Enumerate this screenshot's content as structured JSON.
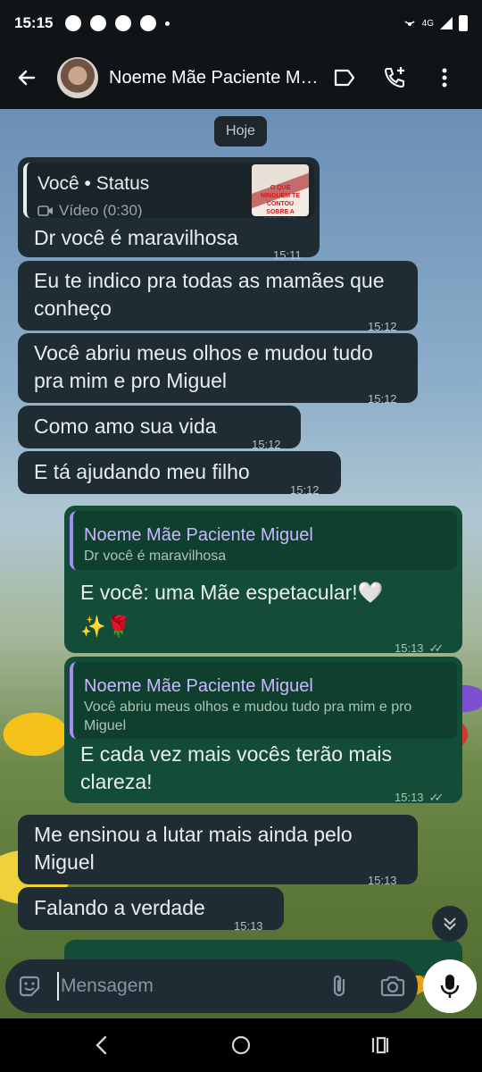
{
  "status_bar": {
    "time": "15:15",
    "network": "4G"
  },
  "header": {
    "contact_name": "Noeme Mãe Paciente Miguel",
    "icons": [
      "back-arrow-icon",
      "label-icon",
      "add-call-icon",
      "more-vert-icon"
    ]
  },
  "chat": {
    "date_label": "Hoje",
    "status_reply": {
      "title": "Você • Status",
      "subtitle": "Vídeo (0:30)",
      "thumb_text": "O QUE NINGUÉM TE CONTOU SOBRE A PREGUIÇA"
    },
    "messages": [
      {
        "dir": "in",
        "text": "Dr você é maravilhosa",
        "time": "15:11"
      },
      {
        "dir": "in",
        "text": "Eu te indico pra todas as mamães que conheço",
        "time": "15:12"
      },
      {
        "dir": "in",
        "text": "Você abriu meus olhos e mudou tudo pra mim e pro Miguel",
        "time": "15:12"
      },
      {
        "dir": "in",
        "text": "Como amo sua vida",
        "time": "15:12"
      },
      {
        "dir": "in",
        "text": "E tá ajudando meu filho",
        "time": "15:12"
      },
      {
        "dir": "out",
        "quote_name": "Noeme Mãe Paciente Miguel",
        "quote_text": "Dr você é maravilhosa",
        "text": "E você: uma Mãe espetacular!🤍\n✨🌹",
        "time": "15:13"
      },
      {
        "dir": "out",
        "quote_name": "Noeme Mãe Paciente Miguel",
        "quote_text": "Você abriu meus olhos e mudou tudo pra mim e pro Miguel",
        "text": "E cada vez mais vocês terão mais clareza!",
        "time": "15:13"
      },
      {
        "dir": "in",
        "text": "Me ensinou a lutar mais ainda pelo Miguel",
        "time": "15:13"
      },
      {
        "dir": "in",
        "text": "Falando a verdade",
        "time": "15:13"
      }
    ]
  },
  "composer": {
    "placeholder": "Mensagem"
  }
}
